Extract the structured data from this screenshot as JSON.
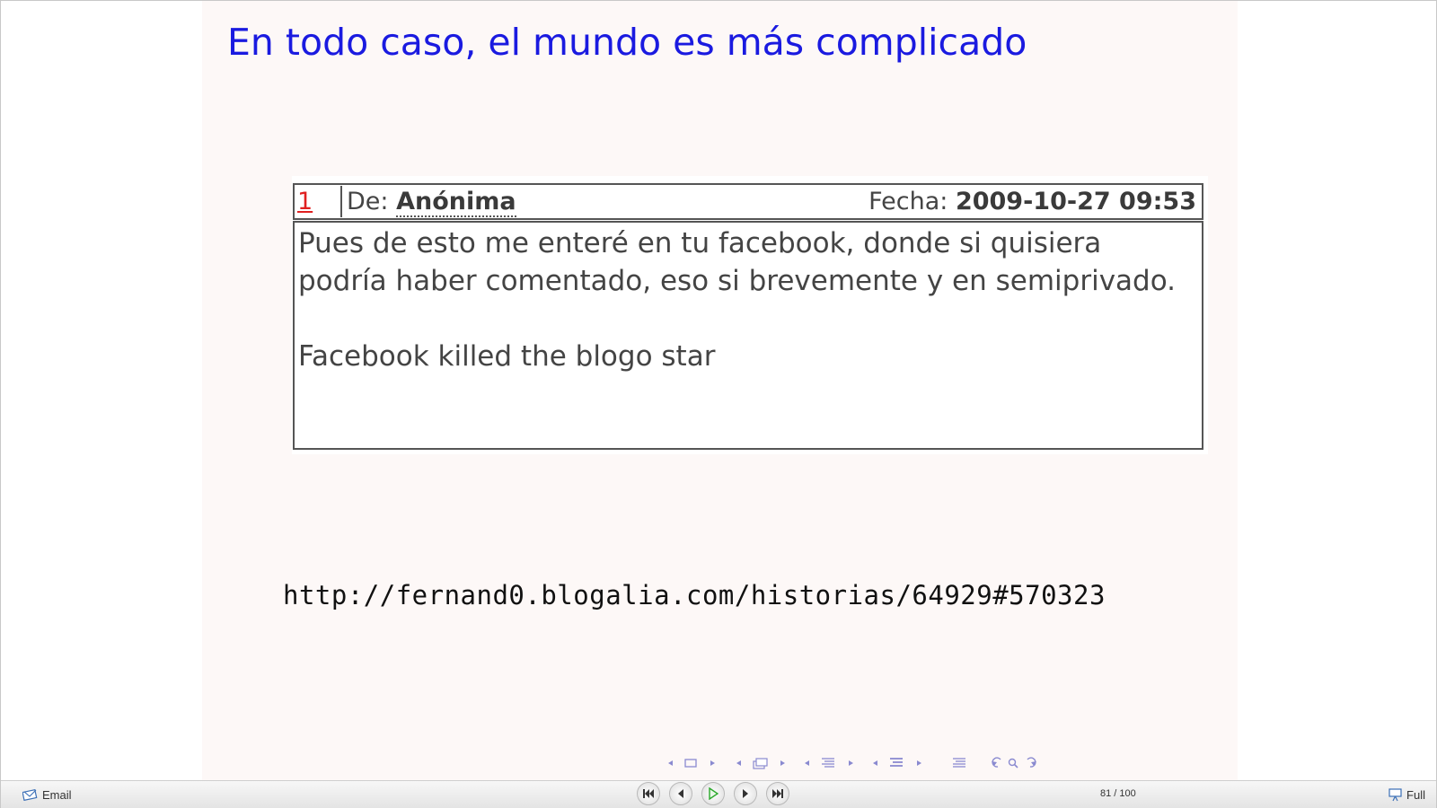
{
  "slide": {
    "title": "En todo caso, el mundo es más complicado",
    "comment": {
      "number": "1",
      "from_label": "De:",
      "author": "Anónima",
      "date_label": "Fecha:",
      "date": "2009-10-27 09:53",
      "body_1": "Pues de esto me enteré en tu facebook, donde si quisiera podría haber comentado, eso si brevemente y en semiprivado.",
      "body_2": "Facebook killed the blogo star"
    },
    "url": "http://fernand0.blogalia.com/historias/64929#570323"
  },
  "toolbar": {
    "email_label": "Email",
    "page_indicator": "81 / 100",
    "full_label": "Full"
  },
  "colors": {
    "title": "#1a1ae0",
    "slide_bg": "#fdf8f7",
    "nav_symbols": "#8a8ad0",
    "play_green": "#2aa82a"
  },
  "icons": {
    "email": "envelope-icon",
    "first": "skip-first-icon",
    "prev": "previous-icon",
    "play": "play-icon",
    "next": "next-icon",
    "last": "skip-last-icon",
    "full": "presentation-icon"
  }
}
